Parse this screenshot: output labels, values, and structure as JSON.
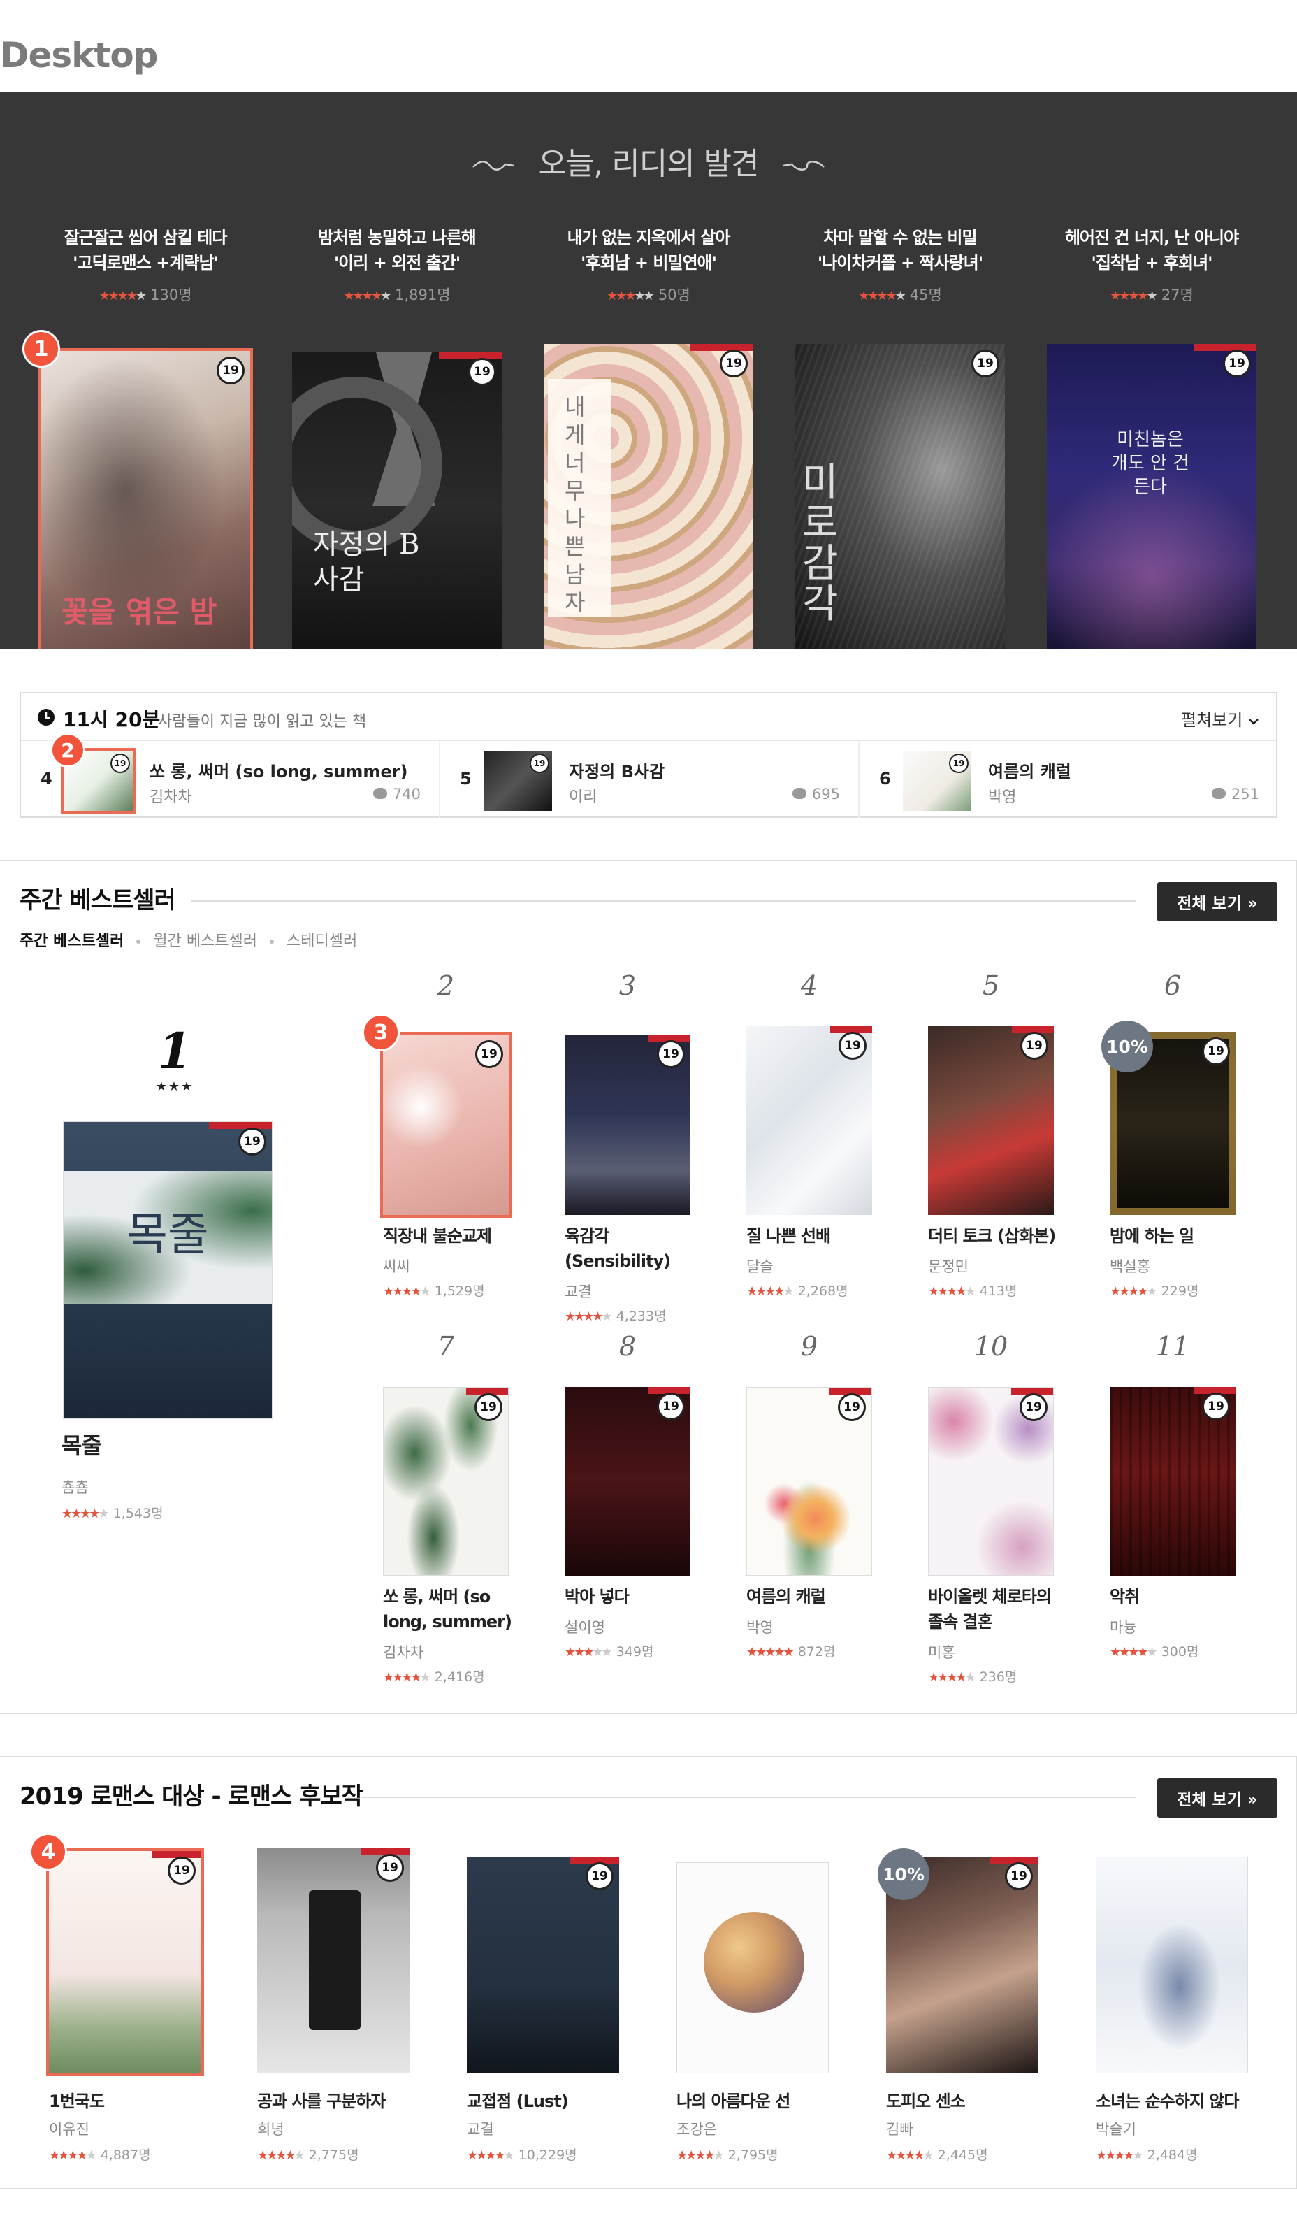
{
  "page_label": "Desktop",
  "hero": {
    "title": "오늘, 리디의 발견",
    "picks": [
      {
        "line1": "잘근잘근 씹어 삼킬 테다",
        "line2": "'고딕로맨스 +계략남'",
        "stars": 4,
        "count": "130명"
      },
      {
        "line1": "밤처럼 농밀하고 나른해",
        "line2": "'이리 + 외전 출간'",
        "stars": 4,
        "count": "1,891명"
      },
      {
        "line1": "내가 없는 지옥에서 살아",
        "line2": "'후회남 + 비밀연애'",
        "stars": 3.5,
        "count": "50명"
      },
      {
        "line1": "차마 말할 수 없는 비밀",
        "line2": "'나이차커플 + 짝사랑녀'",
        "stars": 4,
        "count": "45명"
      },
      {
        "line1": "헤어진 건 너지, 난 아니야",
        "line2": "'집착남 + 후회녀'",
        "stars": 4,
        "count": "27명"
      }
    ],
    "cover_titles": [
      "꽃을 엮은 밤",
      "자정의 B사감",
      "내게 너무 나쁜 남자",
      "미로감각",
      "미친놈은 개도 안 건든다"
    ],
    "age_badge": "19",
    "marker": "1"
  },
  "trending": {
    "time": "11시 20분",
    "subtitle": "사람들이 지금 많이 읽고 있는 책",
    "more_label": "펼쳐보기",
    "marker": "2",
    "items": [
      {
        "rank": "4",
        "title": "쏘 롱, 써머 (so long, summer)",
        "author": "김차차",
        "count": "740"
      },
      {
        "rank": "5",
        "title": "자정의 B사감",
        "author": "이리",
        "count": "695"
      },
      {
        "rank": "6",
        "title": "여름의 캐럴",
        "author": "박영",
        "count": "251"
      }
    ]
  },
  "weekly": {
    "title": "주간 베스트셀러",
    "all_label": "전체 보기 »",
    "tabs": [
      "주간 베스트셀러",
      "월간 베스트셀러",
      "스테디셀러"
    ],
    "marker": "3",
    "first": {
      "rank": "1",
      "stars_mark": "★★★",
      "title": "목줄",
      "author": "춈춈",
      "stars": 4.5,
      "count": "1,543명"
    },
    "books": [
      {
        "rank": "2",
        "title": "직장내 불순교제",
        "author": "씨씨",
        "stars": 4.5,
        "count": "1,529명"
      },
      {
        "rank": "3",
        "title": "육감각 (Sensibility)",
        "author": "교결",
        "stars": 4,
        "count": "4,233명"
      },
      {
        "rank": "4",
        "title": "질 나쁜 선배",
        "author": "달슬",
        "stars": 4.5,
        "count": "2,268명"
      },
      {
        "rank": "5",
        "title": "더티 토크 (삽화본)",
        "author": "문정민",
        "stars": 4,
        "count": "413명"
      },
      {
        "rank": "6",
        "title": "밤에 하는 일",
        "author": "백설홍",
        "stars": 4.5,
        "count": "229명",
        "discount": "10%"
      },
      {
        "rank": "7",
        "title": "쏘 롱, 써머 (so long, summer)",
        "author": "김차차",
        "stars": 4.5,
        "count": "2,416명"
      },
      {
        "rank": "8",
        "title": "박아 넣다",
        "author": "설이영",
        "stars": 3.5,
        "count": "349명"
      },
      {
        "rank": "9",
        "title": "여름의 캐럴",
        "author": "박영",
        "stars": 5,
        "count": "872명"
      },
      {
        "rank": "10",
        "title": "바이올렛 체로타의 졸속 결혼",
        "author": "미홍",
        "stars": 4.5,
        "count": "236명"
      },
      {
        "rank": "11",
        "title": "악취",
        "author": "마늉",
        "stars": 4,
        "count": "300명"
      }
    ]
  },
  "romance": {
    "title": "2019 로맨스 대상 - 로맨스 후보작",
    "all_label": "전체 보기 »",
    "marker": "4",
    "books": [
      {
        "title": "1번국도",
        "author": "이유진",
        "stars": 4.5,
        "count": "4,887명"
      },
      {
        "title": "공과 사를 구분하자",
        "author": "희녕",
        "stars": 4.5,
        "count": "2,775명"
      },
      {
        "title": "교접점 (Lust)",
        "author": "교결",
        "stars": 4,
        "count": "10,229명"
      },
      {
        "title": "나의 아름다운 선",
        "author": "조강은",
        "stars": 4.5,
        "count": "2,795명"
      },
      {
        "title": "도피오 센소",
        "author": "김빠",
        "stars": 4.5,
        "count": "2,445명",
        "discount": "10%"
      },
      {
        "title": "소녀는 순수하지 않다",
        "author": "박슬기",
        "stars": 4.5,
        "count": "2,484명"
      }
    ]
  },
  "colors": {
    "accent": "#f2543b",
    "star": "#e2543e",
    "hero_bg": "#373737",
    "button": "#2b2b2b"
  }
}
